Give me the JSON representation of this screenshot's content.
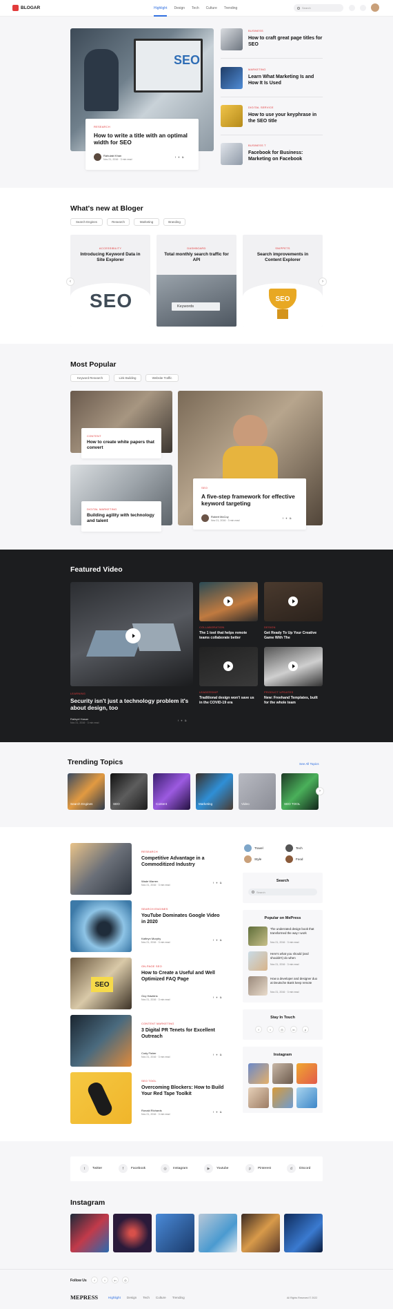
{
  "header": {
    "logo": "BLOGAR",
    "nav": [
      "Highlight",
      "Design",
      "Tech",
      "Culture",
      "Trending"
    ],
    "search_placeholder": "Search"
  },
  "hero": {
    "main": {
      "category": "RESEARCH",
      "title": "How to write a title with an optimal width for SEO",
      "author": "Rahulakt Khan",
      "date": "Nov 21, 2016 · 3 min read"
    },
    "side": [
      {
        "category": "BUSINESS",
        "title": "How to craft great page titles for SEO"
      },
      {
        "category": "MARKETING",
        "title": "Learn What Marketing Is and How It Is Used"
      },
      {
        "category": "DIGITAL SERVICE",
        "title": "How to use your keyphrase in the SEO title"
      },
      {
        "category": "BUSINESS T",
        "title": "Facebook for Business: Marketing on Facebook"
      }
    ]
  },
  "whats_new": {
    "title": "What's new at Bloger",
    "chips": [
      "Search Engines",
      "Research",
      "Marketing",
      "Branding"
    ],
    "cards": [
      {
        "category": "ACCESSIBILITY",
        "title": "Introducing Keyword Data in Site Explorer",
        "art": "SEO"
      },
      {
        "category": "DASHBOARD",
        "title": "Total monthly search traffic for API",
        "art": "Keywords"
      },
      {
        "category": "SNIPPETS",
        "title": "Search improvements in Content Explorer",
        "art": "SEO"
      }
    ]
  },
  "popular": {
    "title": "Most Popular",
    "chips": [
      "Keyword Research",
      "Link Building",
      "Website Traffic"
    ],
    "a": {
      "category": "CONTENT",
      "title": "How to create white papers that convert"
    },
    "b": {
      "category": "DIGITAL MARKETING",
      "title": "Building agility with technology and talent"
    },
    "c": {
      "category": "SEO",
      "title": "A five-step framework for effective keyword targeting",
      "author": "Robert McCoy",
      "date": "Nov 21, 2016 · 3 min read"
    }
  },
  "video": {
    "title": "Featured Video",
    "main": {
      "category": "LEARNING",
      "title": "Security isn't just a technology problem it's about design, too",
      "author": "Rafayel Hasan",
      "date": "Nov 21, 2016 · 3 min read"
    },
    "items": [
      {
        "category": "COLLABORATION",
        "title": "The 1 tool that helps remote teams collaborate better"
      },
      {
        "category": "DESIGN",
        "title": "Get Ready To Up Your Creative Game With The"
      },
      {
        "category": "LEADERSHIP",
        "title": "Traditional design won't save us in the COVID-19 era"
      },
      {
        "category": "PRODUCT UPDATES",
        "title": "New: Freehand Templates, built for the whole team"
      }
    ]
  },
  "trending": {
    "title": "Trending Topics",
    "see_all": "See All Topics",
    "topics": [
      "Search Engines",
      "SEO",
      "Content",
      "Marketing",
      "Video",
      "SEO TOOL"
    ]
  },
  "posts": [
    {
      "category": "RESEARCH",
      "title": "Competitive Advantage in a Commoditized Industry",
      "author": "Wade Warren",
      "date": "Nov 21, 2016 · 3 min read"
    },
    {
      "category": "SEARCH ENGINES",
      "title": "YouTube Dominates Google Video in 2020",
      "author": "Kathryn Murphy",
      "date": "Nov 21, 2016 · 3 min read"
    },
    {
      "category": "ON-PAGE SEO",
      "title": "How to Create a Useful and Well Optimized FAQ Page",
      "author": "Guy Hawkins",
      "date": "Nov 21, 2016 · 3 min read"
    },
    {
      "category": "CONTENT MARKETING",
      "title": "3 Digital PR Tenets for Excellent Outreach",
      "author": "Cody Fisher",
      "date": "Nov 21, 2016 · 3 min read"
    },
    {
      "category": "SEO TOOL",
      "title": "Overcoming Blockers: How to Build Your Red Tape Toolkit",
      "author": "Ronald Richards",
      "date": "Nov 21, 2016 · 3 min read"
    }
  ],
  "sidebar": {
    "cats": [
      "Travel",
      "Tech",
      "Style",
      "Food"
    ],
    "search_title": "Search",
    "search_placeholder": "Search",
    "popular_title": "Popular on MePress",
    "popular": [
      {
        "title": "The underrated design book that transformed the way I work",
        "date": "Nov 21, 2016 · 3 min read"
      },
      {
        "title": "Here's what you should (and shouldn't) do when",
        "date": "Nov 21, 2016 · 3 min read"
      },
      {
        "title": "How a developer and designer duo at Deutsche Bank keep remote",
        "date": "Nov 21, 2016 · 3 min read"
      }
    ],
    "stay_title": "Stay In Touch",
    "insta_title": "Instagram"
  },
  "social": [
    {
      "label": "Twitter",
      "icon": "twitter-icon"
    },
    {
      "label": "Facebook",
      "icon": "facebook-icon"
    },
    {
      "label": "Instagram",
      "icon": "instagram-icon"
    },
    {
      "label": "Youtube",
      "icon": "youtube-icon"
    },
    {
      "label": "Pinterest",
      "icon": "pinterest-icon"
    },
    {
      "label": "Discord",
      "icon": "discord-icon"
    }
  ],
  "instagram_title": "Instagram",
  "footer": {
    "follow": "Follow Us",
    "logo": "MEPRESS",
    "nav": [
      "Highlight",
      "Design",
      "Tech",
      "Culture",
      "Trending"
    ],
    "copyright": "All Rights Reserved © 2022"
  },
  "colors": {
    "accent": "#e23b3b",
    "dark": "#1b1b1b",
    "link": "#2f6fe0"
  }
}
